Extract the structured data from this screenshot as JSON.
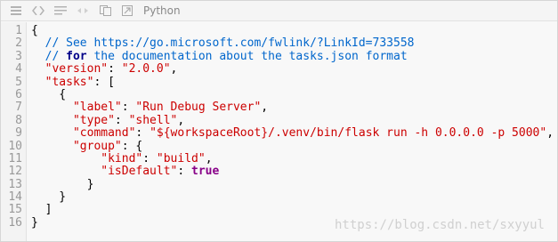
{
  "toolbar": {
    "icons": [
      "list-icon",
      "code-icon",
      "wrap-lines-icon",
      "fullscreen-icon",
      "copy-icon",
      "popout-icon"
    ],
    "language": "Python"
  },
  "code": {
    "line_numbers": [
      "1",
      "2",
      "3",
      "4",
      "5",
      "6",
      "7",
      "8",
      "9",
      "10",
      "11",
      "12",
      "13",
      "14",
      "15",
      "16"
    ],
    "l1": {
      "a": "{"
    },
    "l2": {
      "a": "  // See https://go.microsoft.com/fwlink/?LinkId=733558"
    },
    "l3": {
      "a": "  // ",
      "kw": "for",
      "b": " the documentation about the tasks.json format"
    },
    "l4": {
      "key": "  \"version\"",
      "p": ": ",
      "val": "\"2.0.0\"",
      "e": ","
    },
    "l5": {
      "key": "  \"tasks\"",
      "p": ": ["
    },
    "l6": {
      "a": "    {"
    },
    "l7": {
      "key": "      \"label\"",
      "p": ": ",
      "val": "\"Run Debug Server\"",
      "e": ","
    },
    "l8": {
      "key": "      \"type\"",
      "p": ": ",
      "val": "\"shell\"",
      "e": ","
    },
    "l9": {
      "key": "      \"command\"",
      "p": ": ",
      "val": "\"${workspaceRoot}/.venv/bin/flask run -h 0.0.0.0 -p 5000\"",
      "e": ","
    },
    "l10": {
      "key": "      \"group\"",
      "p": ": {"
    },
    "l11": {
      "key": "          \"kind\"",
      "p": ": ",
      "val": "\"build\"",
      "e": ","
    },
    "l12": {
      "key": "          \"isDefault\"",
      "p": ": ",
      "bool": "true"
    },
    "l13": {
      "a": "        }"
    },
    "l14": {
      "a": "    }"
    },
    "l15": {
      "a": "  ]"
    },
    "l16": {
      "a": "}"
    }
  },
  "watermark": "https://blog.csdn.net/sxyyul"
}
